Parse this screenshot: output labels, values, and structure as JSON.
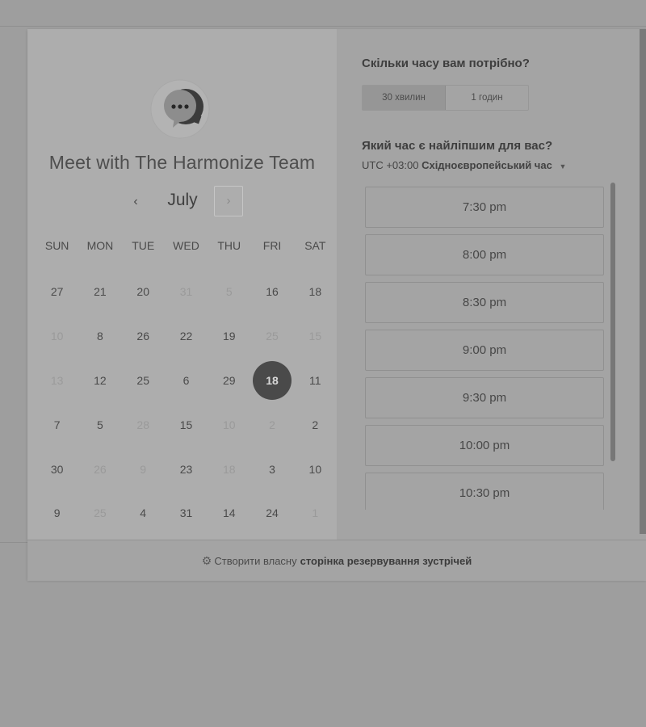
{
  "meeting": {
    "title": "Meet with The Harmonize Team",
    "month": "July",
    "prev_icon": "‹",
    "next_icon": "›"
  },
  "calendar": {
    "weekdays": [
      "SUN",
      "MON",
      "TUE",
      "WED",
      "THU",
      "FRI",
      "SAT"
    ],
    "weeks": [
      [
        {
          "d": "27",
          "dis": false
        },
        {
          "d": "21",
          "dis": false
        },
        {
          "d": "20",
          "dis": false
        },
        {
          "d": "31",
          "dis": true
        },
        {
          "d": "5",
          "dis": true
        },
        {
          "d": "16",
          "dis": false
        },
        {
          "d": "18",
          "dis": false
        }
      ],
      [
        {
          "d": "10",
          "dis": true
        },
        {
          "d": "8",
          "dis": false
        },
        {
          "d": "26",
          "dis": false
        },
        {
          "d": "22",
          "dis": false
        },
        {
          "d": "19",
          "dis": false
        },
        {
          "d": "25",
          "dis": true
        },
        {
          "d": "15",
          "dis": true
        }
      ],
      [
        {
          "d": "13",
          "dis": true
        },
        {
          "d": "12",
          "dis": false
        },
        {
          "d": "25",
          "dis": false
        },
        {
          "d": "6",
          "dis": false
        },
        {
          "d": "29",
          "dis": false
        },
        {
          "d": "18",
          "dis": false,
          "sel": true
        },
        {
          "d": "11",
          "dis": false
        }
      ],
      [
        {
          "d": "7",
          "dis": false
        },
        {
          "d": "5",
          "dis": false
        },
        {
          "d": "28",
          "dis": true
        },
        {
          "d": "15",
          "dis": false
        },
        {
          "d": "10",
          "dis": true
        },
        {
          "d": "2",
          "dis": true
        },
        {
          "d": "2",
          "dis": false
        }
      ],
      [
        {
          "d": "30",
          "dis": false
        },
        {
          "d": "26",
          "dis": true
        },
        {
          "d": "9",
          "dis": true
        },
        {
          "d": "23",
          "dis": false
        },
        {
          "d": "18",
          "dis": true
        },
        {
          "d": "3",
          "dis": false
        },
        {
          "d": "10",
          "dis": false
        }
      ],
      [
        {
          "d": "9",
          "dis": false
        },
        {
          "d": "25",
          "dis": true
        },
        {
          "d": "4",
          "dis": false
        },
        {
          "d": "31",
          "dis": false
        },
        {
          "d": "14",
          "dis": false
        },
        {
          "d": "24",
          "dis": false
        },
        {
          "d": "1",
          "dis": true
        }
      ]
    ]
  },
  "duration": {
    "question": "Скільки часу вам потрібно?",
    "options": [
      "30 хвилин",
      "1 годин"
    ],
    "selected": "30 хвилин"
  },
  "time": {
    "question": "Який час є найліпшим для вас?",
    "tz_offset": "UTC +03:00",
    "tz_name": "Східноєвропейський час",
    "slots": [
      "7:30 pm",
      "8:00 pm",
      "8:30 pm",
      "9:00 pm",
      "9:30 pm",
      "10:00 pm",
      "10:30 pm"
    ]
  },
  "footer": {
    "text": "Створити власну",
    "bold": "сторінка резервування зустрічей"
  },
  "icons": {
    "logo": "chat-bubble-logo-icon",
    "footer": "sprocket-icon",
    "caret": "caret-down-icon"
  }
}
